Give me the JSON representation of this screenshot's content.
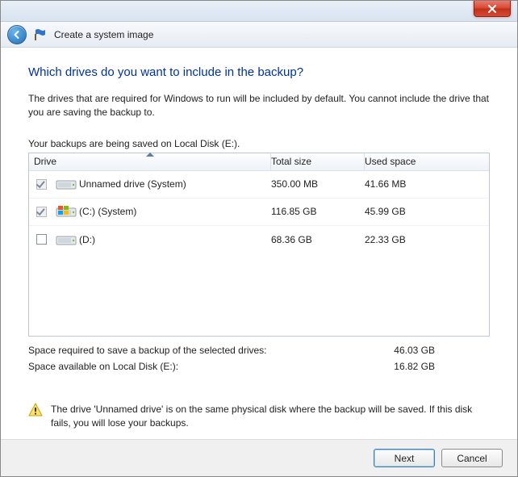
{
  "window": {
    "title": "Create a system image"
  },
  "page": {
    "heading": "Which drives do you want to include in the backup?",
    "description": "The drives that are required for Windows to run will be included by default. You cannot include the drive that you are saving the backup to.",
    "saved_location": "Your backups are being saved on Local Disk (E:)."
  },
  "table": {
    "headers": {
      "drive": "Drive",
      "total": "Total size",
      "used": "Used space"
    },
    "rows": [
      {
        "checked": true,
        "disabled": true,
        "icon": "hdd",
        "name": "Unnamed drive (System)",
        "total": "350.00 MB",
        "used": "41.66 MB"
      },
      {
        "checked": true,
        "disabled": true,
        "icon": "hdd-win",
        "name": "(C:) (System)",
        "total": "116.85 GB",
        "used": "45.99 GB"
      },
      {
        "checked": false,
        "disabled": false,
        "icon": "hdd",
        "name": "(D:)",
        "total": "68.36 GB",
        "used": "22.33 GB"
      }
    ]
  },
  "summary": {
    "required_label": "Space required to save a backup of the selected drives:",
    "required_value": "46.03 GB",
    "available_label": "Space available on Local Disk (E:):",
    "available_value": "16.82 GB"
  },
  "warning": {
    "text": "The drive 'Unnamed drive' is on the same physical disk where the backup will be saved. If this disk fails, you will lose your backups."
  },
  "buttons": {
    "next": "Next",
    "cancel": "Cancel"
  }
}
